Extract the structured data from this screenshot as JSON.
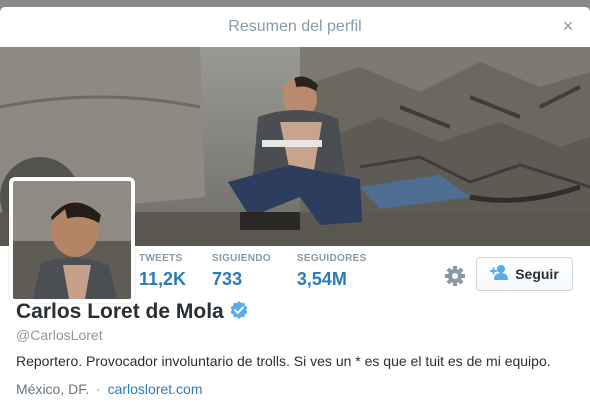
{
  "dialog": {
    "title": "Resumen del perfil",
    "close_label": "×"
  },
  "profile": {
    "name": "Carlos Loret de Mola",
    "handle": "@CarlosLoret",
    "bio": "Reportero. Provocador involuntario de trolls. Si ves un * es que el tuit es de mi equipo.",
    "location": "México, DF.",
    "separator": "·",
    "website": "carlosloret.com",
    "verified": true
  },
  "stats": [
    {
      "label": "TWEETS",
      "value": "11,2K"
    },
    {
      "label": "SIGUIENDO",
      "value": "733"
    },
    {
      "label": "SEGUIDORES",
      "value": "3,54M"
    }
  ],
  "actions": {
    "follow_label": "Seguir",
    "settings_icon": "gear-icon",
    "follow_icon": "add-user-icon"
  },
  "colors": {
    "accent": "#2b7bb9",
    "verified": "#55acee",
    "muted": "#8899a6"
  }
}
